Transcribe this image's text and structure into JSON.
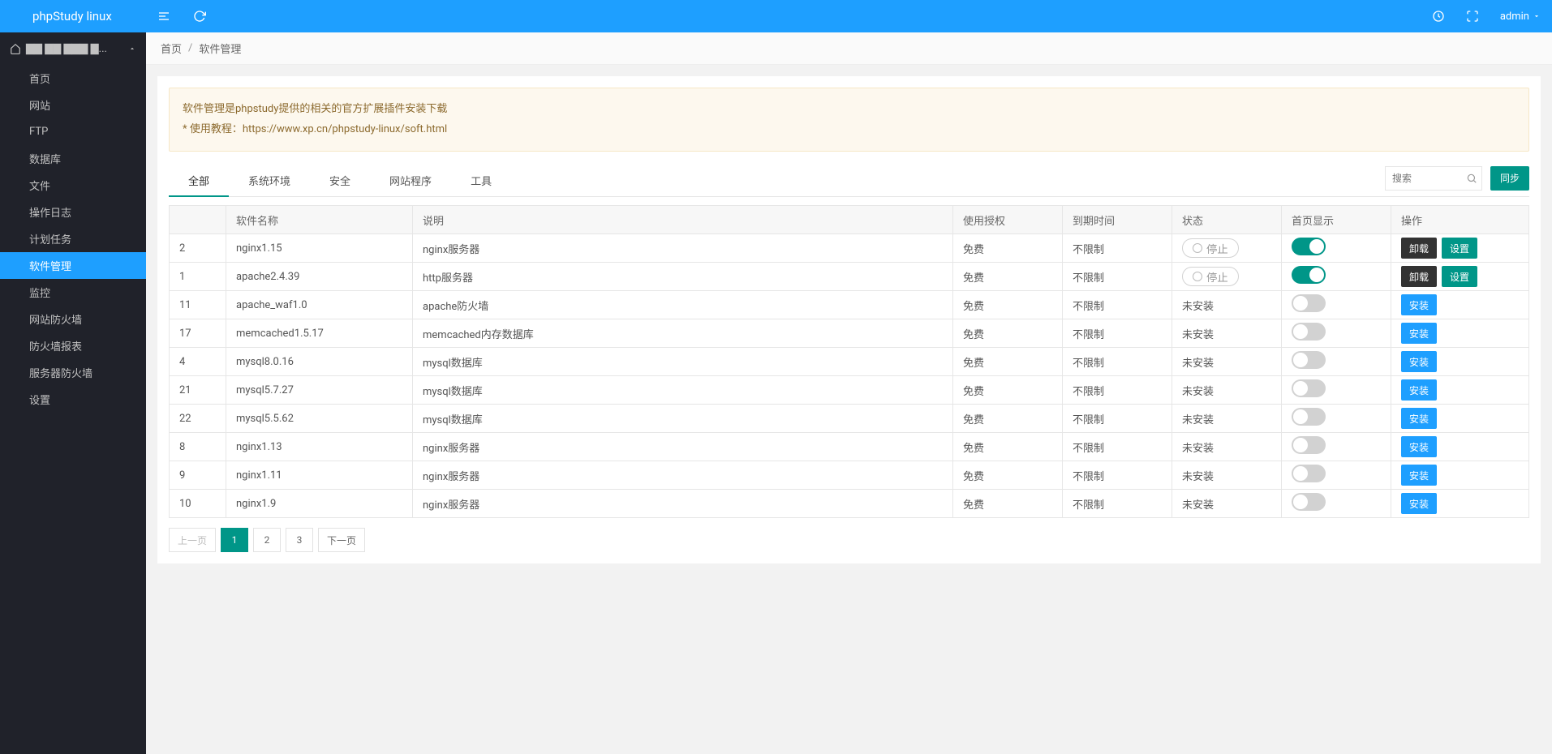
{
  "brand": "phpStudy linux",
  "host_label": "▇▇ ▇▇ ▇▇▇ ▇...",
  "user": "admin",
  "sidebar": [
    {
      "label": "首页"
    },
    {
      "label": "网站"
    },
    {
      "label": "FTP"
    },
    {
      "label": "数据库"
    },
    {
      "label": "文件"
    },
    {
      "label": "操作日志"
    },
    {
      "label": "计划任务"
    },
    {
      "label": "软件管理",
      "active": true
    },
    {
      "label": "监控"
    },
    {
      "label": "网站防火墙"
    },
    {
      "label": "防火墙报表"
    },
    {
      "label": "服务器防火墙"
    },
    {
      "label": "设置"
    }
  ],
  "breadcrumb": {
    "home": "首页",
    "current": "软件管理"
  },
  "notice": {
    "line1": "软件管理是phpstudy提供的相关的官方扩展插件安装下载",
    "line2_prefix": "* 使用教程：",
    "line2_link": "https://www.xp.cn/phpstudy-linux/soft.html"
  },
  "tabs": [
    {
      "label": "全部",
      "active": true
    },
    {
      "label": "系统环境"
    },
    {
      "label": "安全"
    },
    {
      "label": "网站程序"
    },
    {
      "label": "工具"
    }
  ],
  "search_placeholder": "搜索",
  "sync_label": "同步",
  "columns": {
    "id": "",
    "name": "软件名称",
    "desc": "说明",
    "auth": "使用授权",
    "expire": "到期时间",
    "status": "状态",
    "display": "首页显示",
    "action": "操作"
  },
  "status_labels": {
    "stop": "停止",
    "not_installed": "未安装"
  },
  "action_labels": {
    "install": "安装",
    "uninstall": "卸载",
    "settings": "设置"
  },
  "rows": [
    {
      "id": "2",
      "name": "nginx1.15",
      "desc": "nginx服务器",
      "auth": "免费",
      "expire": "不限制",
      "status": "stop",
      "display": true,
      "installed": true
    },
    {
      "id": "1",
      "name": "apache2.4.39",
      "desc": "http服务器",
      "auth": "免费",
      "expire": "不限制",
      "status": "stop",
      "display": true,
      "installed": true
    },
    {
      "id": "11",
      "name": "apache_waf1.0",
      "desc": "apache防火墙",
      "auth": "免费",
      "expire": "不限制",
      "status": "not_installed",
      "display": false,
      "installed": false
    },
    {
      "id": "17",
      "name": "memcached1.5.17",
      "desc": "memcached内存数据库",
      "auth": "免费",
      "expire": "不限制",
      "status": "not_installed",
      "display": false,
      "installed": false
    },
    {
      "id": "4",
      "name": "mysql8.0.16",
      "desc": "mysql数据库",
      "auth": "免费",
      "expire": "不限制",
      "status": "not_installed",
      "display": false,
      "installed": false
    },
    {
      "id": "21",
      "name": "mysql5.7.27",
      "desc": "mysql数据库",
      "auth": "免费",
      "expire": "不限制",
      "status": "not_installed",
      "display": false,
      "installed": false
    },
    {
      "id": "22",
      "name": "mysql5.5.62",
      "desc": "mysql数据库",
      "auth": "免费",
      "expire": "不限制",
      "status": "not_installed",
      "display": false,
      "installed": false
    },
    {
      "id": "8",
      "name": "nginx1.13",
      "desc": "nginx服务器",
      "auth": "免费",
      "expire": "不限制",
      "status": "not_installed",
      "display": false,
      "installed": false
    },
    {
      "id": "9",
      "name": "nginx1.11",
      "desc": "nginx服务器",
      "auth": "免费",
      "expire": "不限制",
      "status": "not_installed",
      "display": false,
      "installed": false
    },
    {
      "id": "10",
      "name": "nginx1.9",
      "desc": "nginx服务器",
      "auth": "免费",
      "expire": "不限制",
      "status": "not_installed",
      "display": false,
      "installed": false
    }
  ],
  "pagination": {
    "prev": "上一页",
    "next": "下一页",
    "pages": [
      "1",
      "2",
      "3"
    ],
    "current": "1"
  }
}
